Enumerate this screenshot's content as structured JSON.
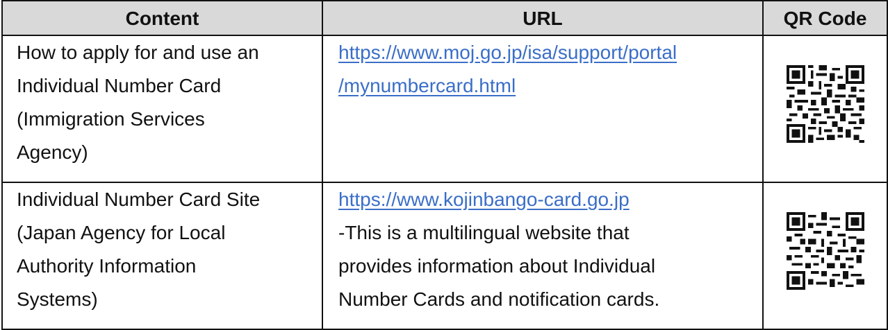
{
  "table": {
    "headers": [
      "Content",
      "URL",
      "QR Code"
    ],
    "rows": [
      {
        "content_lines": [
          "How to apply for and use an",
          "Individual Number Card",
          "(Immigration Services",
          "Agency)"
        ],
        "url_lines": [
          "https://www.moj.go.jp/isa/support/portal",
          "/mynumbercard.html"
        ],
        "description_lines": [],
        "qr_icon": "qr-code-icon"
      },
      {
        "content_lines": [
          "Individual Number Card Site",
          "(Japan Agency for Local",
          "Authority Information",
          "Systems)"
        ],
        "url_lines": [
          "https://www.kojinbango-card.go.jp"
        ],
        "description_lines": [
          "-This is a multilingual website that",
          "provides information about Individual",
          "Number Cards and notification cards."
        ],
        "qr_icon": "qr-code-icon"
      }
    ]
  },
  "colors": {
    "header_background": "#d9d9d9",
    "link": "#3a6ec8",
    "border": "#111111"
  }
}
